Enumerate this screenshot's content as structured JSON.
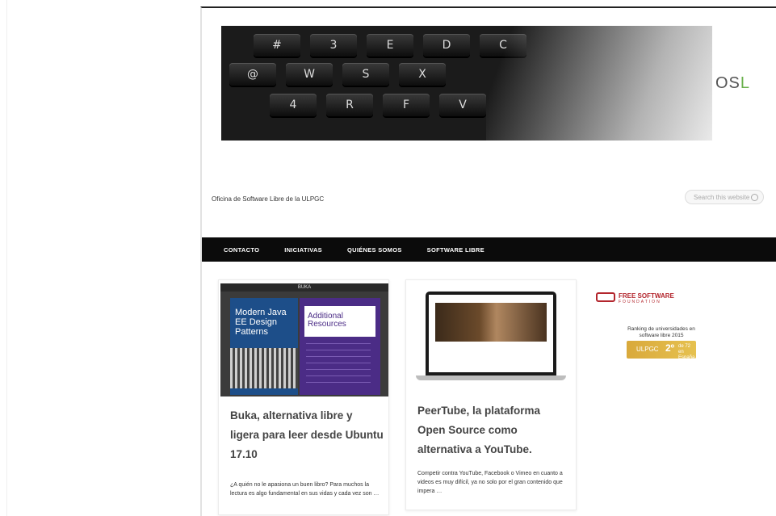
{
  "site": {
    "logo": "OS",
    "logo_accent": "L",
    "tagline": "Oficina de Software Libre de la ULPGC"
  },
  "search": {
    "placeholder": "Search this website"
  },
  "nav": {
    "items": [
      {
        "label": "CONTACTO"
      },
      {
        "label": "INICIATIVAS"
      },
      {
        "label": "QUIÉNES SOMOS"
      },
      {
        "label": "SOFTWARE LIBRE"
      }
    ]
  },
  "header_keys": [
    "#",
    "3",
    "E",
    "D",
    "C",
    "@",
    "W",
    "S",
    "X",
    "4",
    "R",
    "F",
    "V"
  ],
  "posts": [
    {
      "title": "Buka, alternativa libre y ligera para leer desde Ubuntu 17.10",
      "excerpt": "¿A quién no le apasiona un buen libro? Para muchos la lectura es algo fundamental en sus vidas y cada vez son …",
      "thumb_bar": "BUKA",
      "book_title": "Modern Java EE Design Patterns",
      "book_panel": "Additional Resources"
    },
    {
      "title": "PeerTube, la plataforma Open Source como alternativa a YouTube.",
      "excerpt": "Competir contra YouTube, Facebook o Vimeo en cuanto a videos es muy difícil, ya no solo por el gran contenido que impera …"
    }
  ],
  "sidebar": {
    "fsf_name": "FREE SOFTWARE",
    "fsf_sub": "FOUNDATION",
    "ranking_text": "Ranking de universidades en software libre 2015",
    "ranking_left": "ULPGC",
    "ranking_pos": "2º",
    "ranking_right_1": "de 72",
    "ranking_right_2": "en España"
  },
  "colors": {
    "nav_bg": "#0b0b0b",
    "accent": "#6ab04c",
    "fsf": "#b3262d",
    "badge": "#d9a93b"
  }
}
